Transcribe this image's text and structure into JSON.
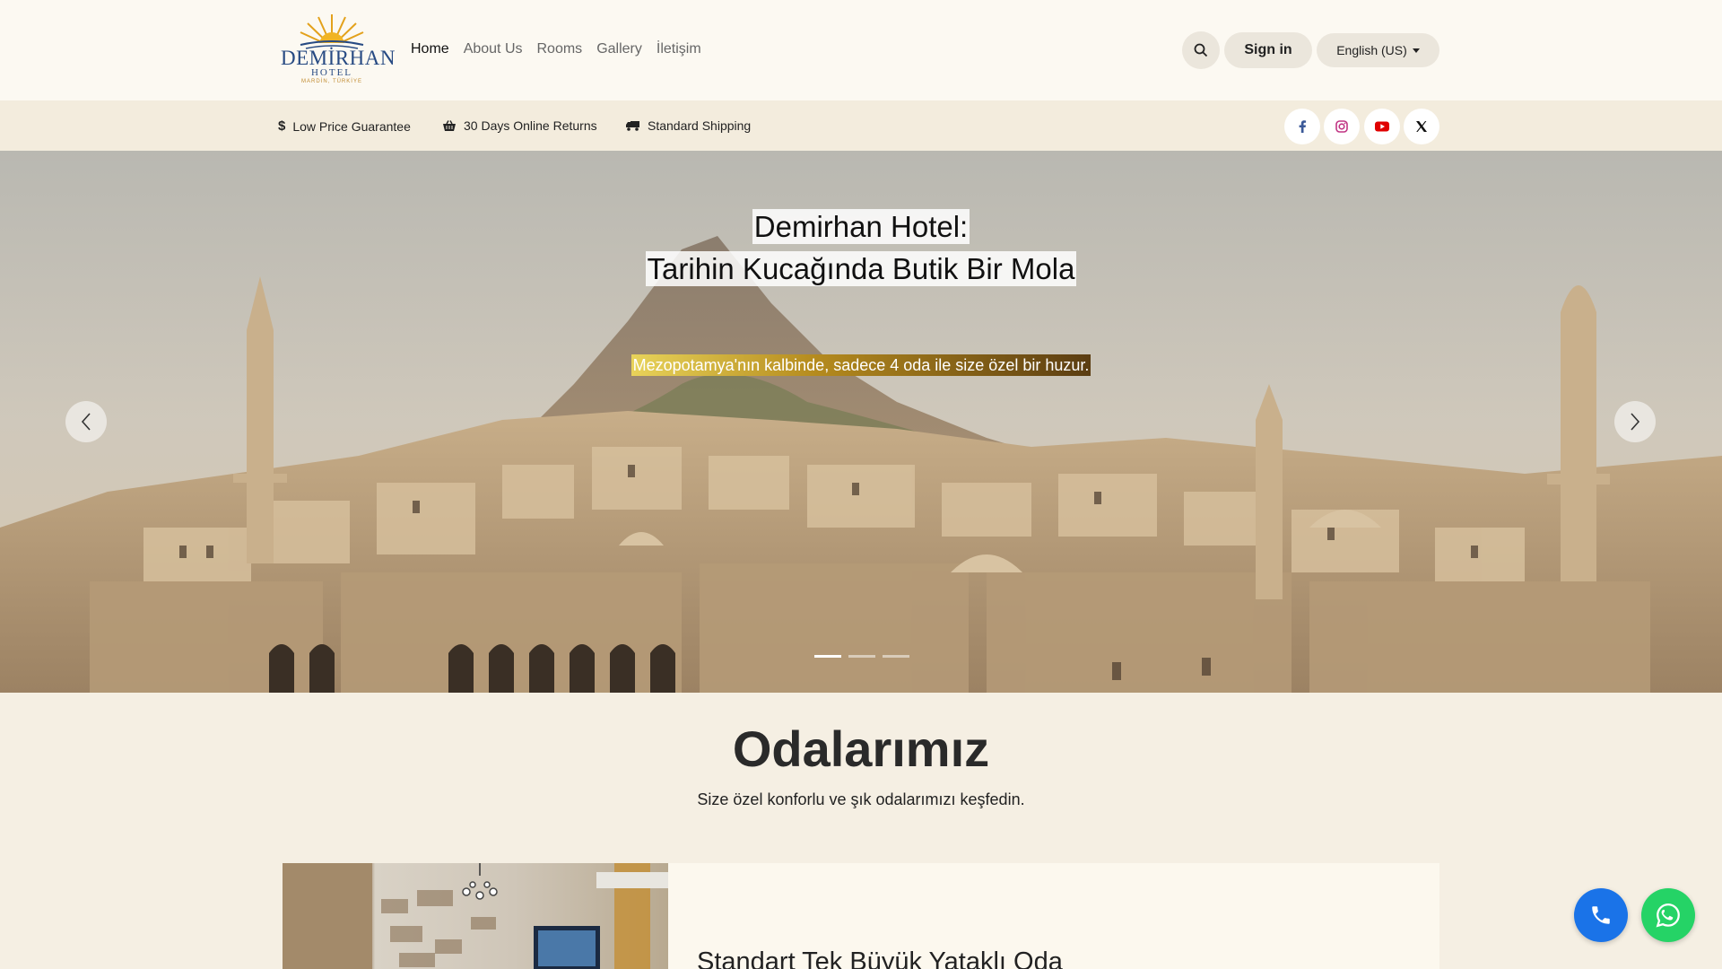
{
  "brand": {
    "name": "DEMİRHAN",
    "sub": "HOTEL",
    "tagline": "MARDİN, TÜRKİYE"
  },
  "nav": {
    "items": [
      "Home",
      "About Us",
      "Rooms",
      "Gallery",
      "İletişim"
    ],
    "active": "Home"
  },
  "header": {
    "search_icon": "search-icon",
    "signin_label": "Sign in",
    "language_label": "English (US)"
  },
  "infobar": {
    "items": [
      {
        "icon": "dollar-icon",
        "label": "Low Price Guarantee"
      },
      {
        "icon": "basket-icon",
        "label": "30 Days Online Returns"
      },
      {
        "icon": "truck-icon",
        "label": "Standard Shipping"
      }
    ],
    "social": [
      {
        "icon": "facebook-icon",
        "color": "#3b5998"
      },
      {
        "icon": "instagram-icon",
        "color": "#c13584"
      },
      {
        "icon": "youtube-icon",
        "color": "#e00000"
      },
      {
        "icon": "x-icon",
        "color": "#111111"
      }
    ]
  },
  "hero": {
    "title_line1": "Demirhan Hotel:",
    "title_line2": "Tarihin Kucağında Butik Bir Mola",
    "subtitle": "Mezopotamya'nın kalbinde, sadece 4 oda ile size özel bir huzur.",
    "slides": 3,
    "active_slide": 1
  },
  "rooms": {
    "title": "Odalarımız",
    "subtitle": "Size özel konforlu ve şık odalarımızı keşfedin.",
    "first_room_name": "Standart Tek Büyük Yataklı Oda"
  },
  "floating": {
    "phone_color": "#1a73e8",
    "whatsapp_color": "#25d366"
  }
}
